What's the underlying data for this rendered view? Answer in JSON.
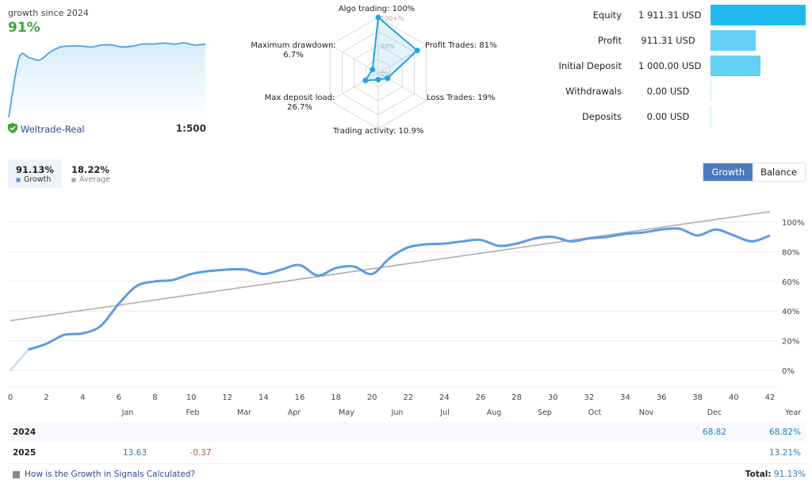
{
  "summary": {
    "caption": "growth since 2024",
    "growth": "91%",
    "broker": "Weltrade-Real",
    "leverage": "1:500",
    "spark_values": [
      0,
      60,
      60,
      58,
      66,
      71,
      72,
      72,
      71,
      73,
      73,
      71,
      72,
      74,
      74,
      75,
      74,
      75,
      73,
      74
    ]
  },
  "radar": {
    "axes": [
      {
        "label": "Algo trading: 100%",
        "name": "algo-trading",
        "value": 100
      },
      {
        "label": "Profit Trades: 81%",
        "name": "profit-trades",
        "value": 81
      },
      {
        "label": "Loss Trades: 19%",
        "name": "loss-trades",
        "value": 19
      },
      {
        "label": "Trading activity: 10.9%",
        "name": "trading-activity",
        "value": 10.9
      },
      {
        "label_line1": "Max deposit load:",
        "label_line2": "26.7%",
        "name": "max-deposit-load",
        "value": 26.7
      },
      {
        "label_line1": "Maximum drawdown:",
        "label_line2": "6.7%",
        "name": "maximum-drawdown",
        "value": 6.7
      }
    ],
    "ring_labels": [
      "100+%",
      "50%",
      "0%"
    ]
  },
  "equity": {
    "rows": [
      {
        "label": "Equity",
        "value": "1 911.31 USD",
        "amount": 1911.31,
        "color": "#1fb8ee"
      },
      {
        "label": "Profit",
        "value": "911.31 USD",
        "amount": 911.31,
        "color": "#63d0f5"
      },
      {
        "label": "Initial Deposit",
        "value": "1 000.00 USD",
        "amount": 1000.0,
        "color": "#63d0f5"
      },
      {
        "label": "Withdrawals",
        "value": "0.00 USD",
        "amount": 0,
        "color": "#bfe9f9"
      },
      {
        "label": "Deposits",
        "value": "0.00 USD",
        "amount": 0,
        "color": "#bfe9f9"
      }
    ]
  },
  "tabs": {
    "growth": {
      "value": "91.13%",
      "label": "Growth",
      "color": "#5b9be6"
    },
    "average": {
      "value": "18.22%",
      "label": "Average",
      "color": "#aaaaaa"
    }
  },
  "switch": {
    "growth": "Growth",
    "balance": "Balance"
  },
  "chart_data": {
    "type": "line",
    "x": [
      0,
      1,
      2,
      3,
      4,
      5,
      6,
      7,
      8,
      9,
      10,
      11,
      12,
      13,
      14,
      15,
      16,
      17,
      18,
      19,
      20,
      21,
      22,
      23,
      24,
      25,
      26,
      27,
      28,
      29,
      30,
      31,
      32,
      33,
      34,
      35,
      36,
      37,
      38,
      39,
      40,
      41,
      42
    ],
    "series": [
      {
        "name": "Growth",
        "color": "#5b9be6",
        "values": [
          0,
          14,
          18,
          24,
          25,
          30,
          45,
          57,
          60,
          61,
          65,
          67,
          68,
          68,
          65,
          68,
          71,
          64,
          69,
          70,
          65,
          76,
          83,
          85,
          85.5,
          87,
          88,
          84,
          85.5,
          89,
          90,
          87,
          89,
          90,
          92,
          93,
          95,
          95.5,
          91,
          95,
          91,
          87,
          91
        ]
      },
      {
        "name": "Average",
        "color": "#aaaaaa",
        "values_endpoints": [
          33.5,
          107
        ]
      }
    ],
    "x_ticks": [
      "0",
      "2",
      "4",
      "6",
      "8",
      "10",
      "12",
      "14",
      "16",
      "18",
      "20",
      "22",
      "24",
      "26",
      "28",
      "30",
      "32",
      "34",
      "36",
      "38",
      "40",
      "42"
    ],
    "y_ticks": [
      "0%",
      "20%",
      "40%",
      "60%",
      "80%",
      "100%"
    ],
    "ylim": [
      0,
      110
    ],
    "xlim": [
      0,
      42
    ],
    "grid": true,
    "month_labels": [
      "Jan",
      "Feb",
      "Mar",
      "Apr",
      "May",
      "Jun",
      "Jul",
      "Aug",
      "Sep",
      "Oct",
      "Nov",
      "Dec",
      "Year"
    ]
  },
  "yearly": {
    "rows": [
      {
        "year": "2024",
        "cells": [
          {
            "month": "Dec",
            "value": "68.82",
            "sign": "pos"
          }
        ],
        "total": "68.82%"
      },
      {
        "year": "2025",
        "cells": [
          {
            "month": "Jan",
            "value": "13.63",
            "sign": "pos"
          },
          {
            "month": "Feb",
            "value": "-0.37",
            "sign": "neg"
          }
        ],
        "total": "13.21%"
      }
    ]
  },
  "footer": {
    "help_link": "How is the Growth in Signals Calculated?",
    "total_label": "Total:",
    "total_value": "91.13%"
  }
}
